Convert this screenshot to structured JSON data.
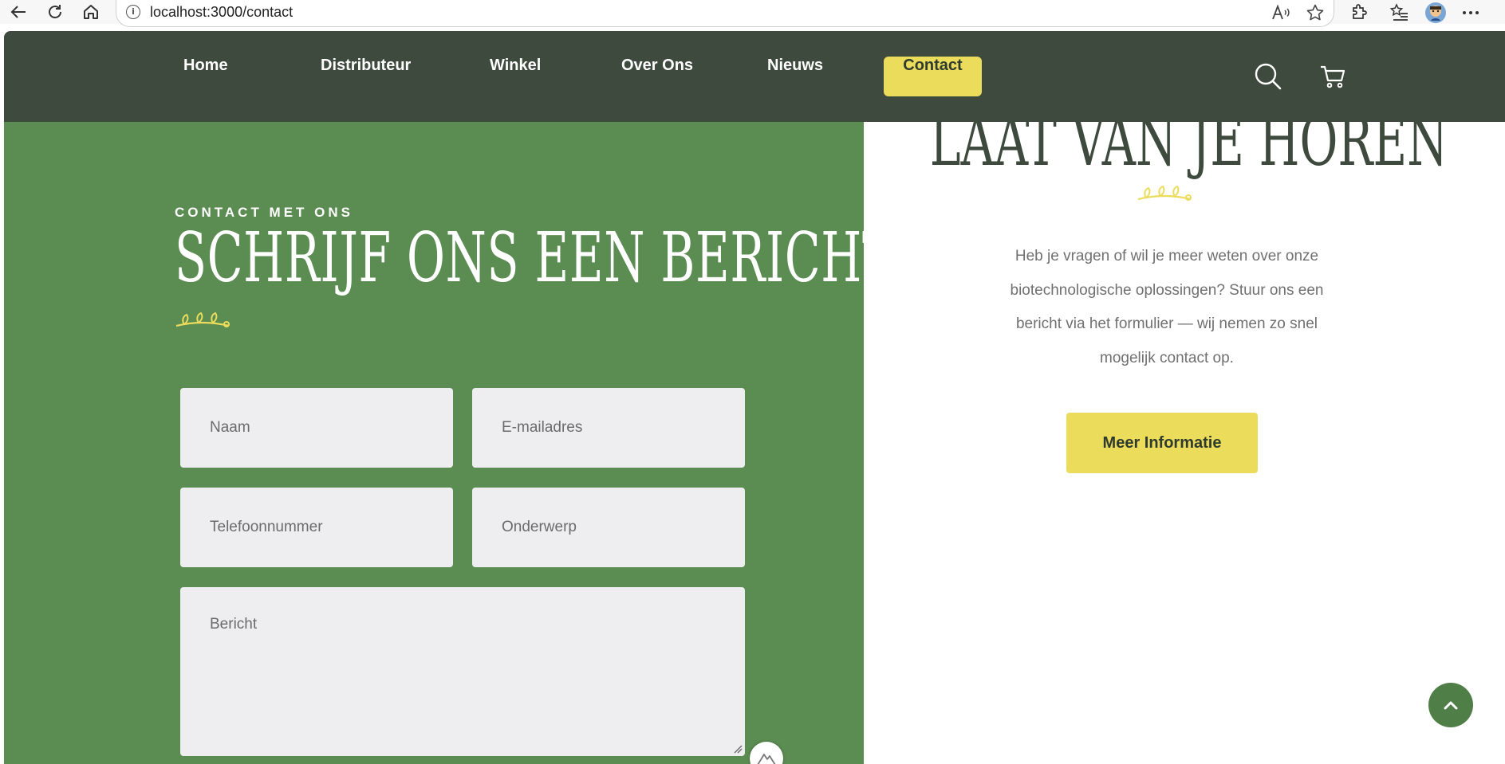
{
  "browser": {
    "url": "localhost:3000/contact",
    "info_glyph": "i"
  },
  "nav": {
    "items": [
      {
        "label": "Home"
      },
      {
        "label": "Distributeur"
      },
      {
        "label": "Winkel"
      },
      {
        "label": "Over Ons"
      },
      {
        "label": "Nieuws"
      },
      {
        "label": "Contact",
        "active": true
      }
    ]
  },
  "contact_form": {
    "eyebrow": "CONTACT MET ONS",
    "title": "SCHRIJF ONS EEN BERICHT",
    "name_placeholder": "Naam",
    "email_placeholder": "E-mailadres",
    "phone_placeholder": "Telefoonnummer",
    "subject_placeholder": "Onderwerp",
    "message_placeholder": "Bericht"
  },
  "info": {
    "title": "LAAT VAN JE HOREN",
    "text": "Heb je vragen of wil je meer weten over onze biotechnologische oplossingen? Stuur ons een bericht via het formulier — wij nemen zo snel mogelijk contact op.",
    "button_label": "Meer Informatie"
  },
  "colors": {
    "header_bg": "#3e4a3d",
    "panel_green": "#5b8c51",
    "accent_yellow": "#ecdc5c",
    "field_bg": "#eeeef0"
  },
  "icons": [
    "back-icon",
    "reload-icon",
    "home-icon",
    "info-icon",
    "read-aloud-icon",
    "favorite-star-icon",
    "extensions-icon",
    "favorites-list-icon",
    "profile-avatar-icon",
    "more-menu-icon",
    "search-icon",
    "cart-icon",
    "sprig-icon",
    "chevron-up-icon"
  ]
}
